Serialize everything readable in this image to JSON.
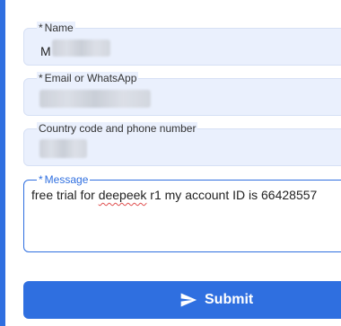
{
  "form": {
    "name": {
      "required_marker": "*",
      "label": "Name",
      "value_visible": "M"
    },
    "email": {
      "required_marker": "*",
      "label": "Email or WhatsApp"
    },
    "phone": {
      "label": "Country code and phone number"
    },
    "message": {
      "required_marker": "*",
      "label": "Message",
      "value_part1": "free trial for ",
      "value_misspelled": "deepeek",
      "value_part2": " r1  my account ID is 66428557"
    },
    "submit": {
      "label": "Submit",
      "icon": "send-icon"
    }
  },
  "colors": {
    "accent": "#2f6fe0",
    "field_bg": "#eaf0fd"
  }
}
